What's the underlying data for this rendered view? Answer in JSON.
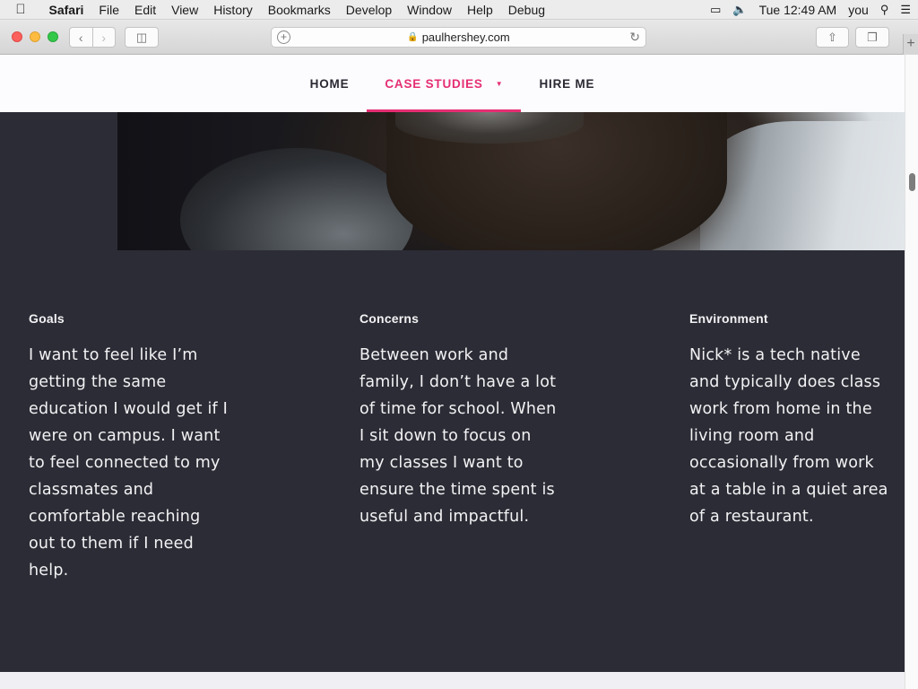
{
  "menubar": {
    "items": [
      "Safari",
      "File",
      "Edit",
      "View",
      "History",
      "Bookmarks",
      "Develop",
      "Window",
      "Help",
      "Debug"
    ],
    "clock": "Tue 12:49 AM",
    "user": "you"
  },
  "browser": {
    "url": "paulhershey.com"
  },
  "site_nav": {
    "items": [
      {
        "label": "HOME"
      },
      {
        "label": "CASE STUDIES"
      },
      {
        "label": "HIRE ME"
      }
    ],
    "accent_color": "#e52e73"
  },
  "columns": [
    {
      "heading": "Goals",
      "body": "I want to feel like I’m getting the same education I would get if I were on campus. I want to feel connected to my classmates and comfortable reaching out to them if I need help."
    },
    {
      "heading": "Concerns",
      "body": "Between work and family, I don’t have a lot of time for school. When I sit down to focus on my classes I want to ensure the time spent is useful and impactful."
    },
    {
      "heading": "Environment",
      "body": "Nick* is a tech native and typically does class work from home in the living room and occasionally from work at a table in a quiet area of a restaurant."
    }
  ],
  "colors": {
    "page_background": "#2c2c36",
    "nav_background": "#fcfbfe",
    "text": "#f2f2f4"
  }
}
